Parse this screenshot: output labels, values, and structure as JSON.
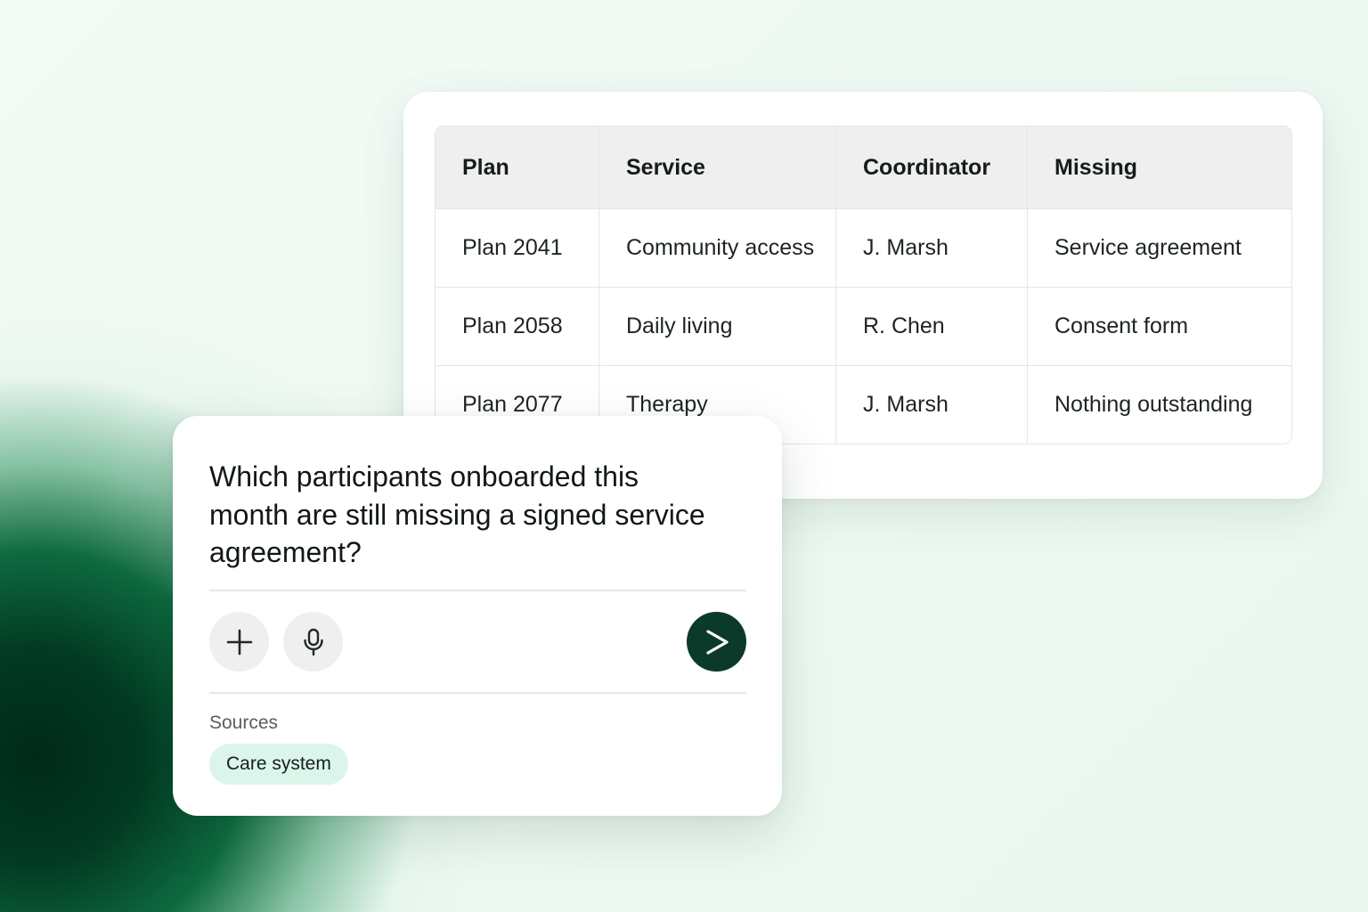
{
  "table": {
    "columns": [
      "Plan",
      "Service",
      "Coordinator",
      "Missing"
    ],
    "rows": [
      [
        "Plan 2041",
        "Community access",
        "J. Marsh",
        "Service agreement"
      ],
      [
        "Plan 2058",
        "Daily living",
        "R. Chen",
        "Consent form"
      ],
      [
        "Plan 2077",
        "Therapy",
        "J. Marsh",
        "Nothing outstanding"
      ]
    ]
  },
  "chat": {
    "question": "Which participants onboarded this month are still missing a signed service agreement?",
    "buttons": {
      "add_icon": "plus-icon",
      "mic_icon": "microphone-icon",
      "send_icon": "send-arrow-icon"
    },
    "sources_label": "Sources",
    "sources": [
      "Care system"
    ]
  },
  "colors": {
    "accent_dark_green": "#0b3a2a",
    "chip_mint": "#dcf5ea",
    "background": "#eef8f2"
  }
}
